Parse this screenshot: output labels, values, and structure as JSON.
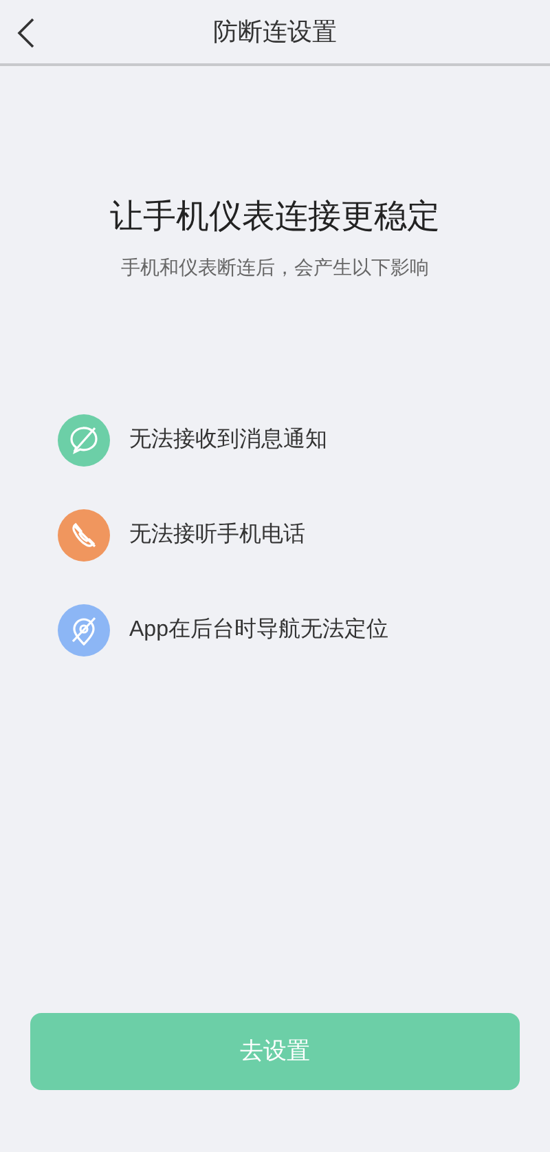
{
  "header": {
    "title": "防断连设置"
  },
  "heading": "让手机仪表连接更稳定",
  "subtitle": "手机和仪表断连后，会产生以下影响",
  "effects": [
    {
      "kind": "message",
      "color": "#6ccfa7",
      "text": "无法接收到消息通知"
    },
    {
      "kind": "phone",
      "color": "#f0965e",
      "text": "无法接听手机电话"
    },
    {
      "kind": "location",
      "color": "#8cb6f5",
      "text": "App在后台时导航无法定位"
    }
  ],
  "button": "去设置"
}
